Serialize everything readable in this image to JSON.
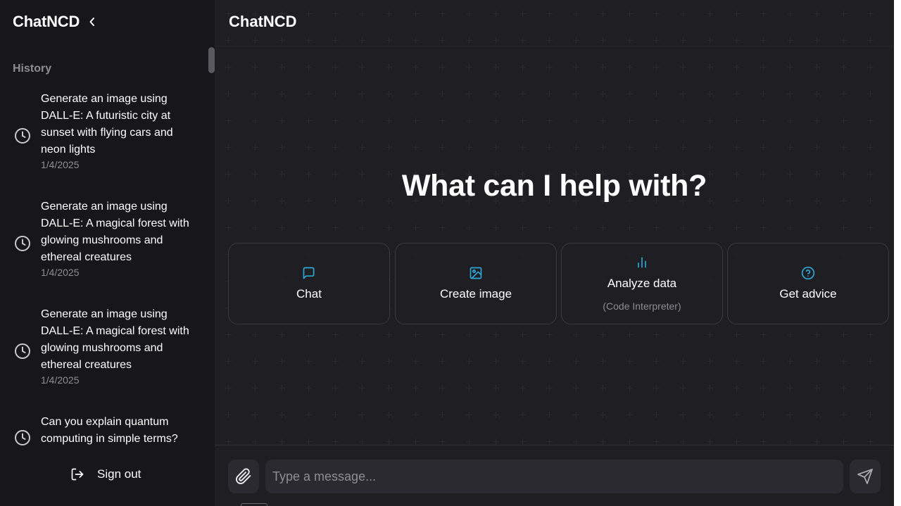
{
  "sidebar": {
    "title": "ChatNCD",
    "history_label": "History",
    "items": [
      {
        "title": "Generate an image using DALL-E: A futuristic city at sunset with flying cars and neon lights",
        "date": "1/4/2025"
      },
      {
        "title": "Generate an image using DALL-E: A magical forest with glowing mushrooms and ethereal creatures",
        "date": "1/4/2025"
      },
      {
        "title": "Generate an image using DALL-E: A magical forest with glowing mushrooms and ethereal creatures",
        "date": "1/4/2025"
      },
      {
        "title": "Can you explain quantum computing in simple terms?",
        "date": ""
      }
    ],
    "signout_label": "Sign out"
  },
  "main": {
    "title": "ChatNCD",
    "hero": "What can I help with?",
    "cards": [
      {
        "label": "Chat",
        "sub": "",
        "icon": "message-square-icon"
      },
      {
        "label": "Create image",
        "sub": "",
        "icon": "image-icon"
      },
      {
        "label": "Analyze data",
        "sub": "(Code Interpreter)",
        "icon": "bar-chart-icon"
      },
      {
        "label": "Get advice",
        "sub": "",
        "icon": "help-circle-icon"
      }
    ]
  },
  "composer": {
    "placeholder": "Type a message...",
    "value": ""
  },
  "colors": {
    "accent": "#2ea8d6",
    "sidebar_bg": "#17161b",
    "main_bg": "#1f1e23",
    "muted_text": "#8e8d94"
  }
}
